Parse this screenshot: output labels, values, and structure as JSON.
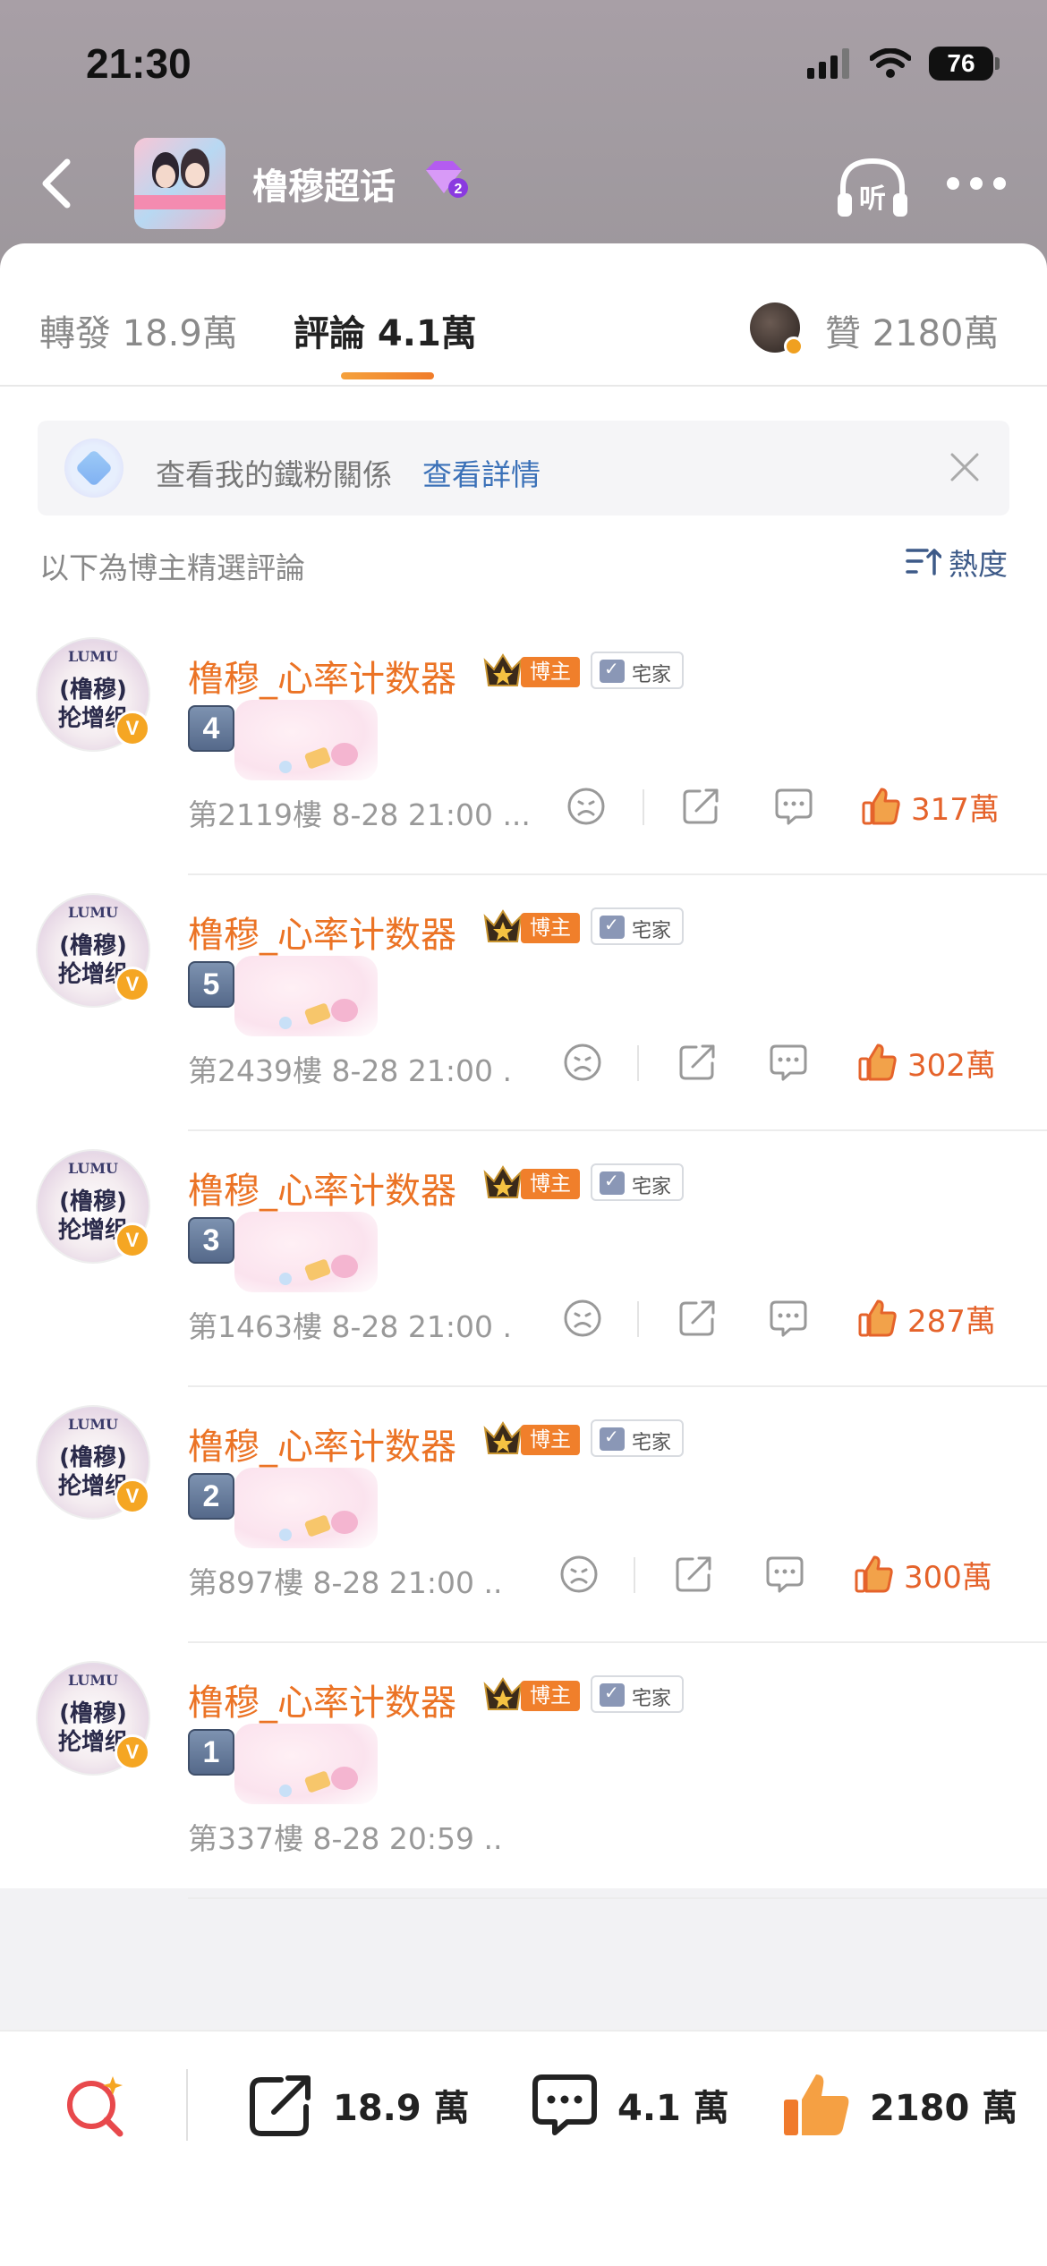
{
  "status_bar": {
    "time": "21:30",
    "battery": "76"
  },
  "header": {
    "group_name": "橹穆超话",
    "listen_label": "听"
  },
  "tabs": {
    "repost": "轉發 18.9萬",
    "comment": "評論 4.1萬",
    "likes": "贊 2180萬"
  },
  "fans_banner": {
    "text": "查看我的鐵粉關係",
    "link": "查看詳情"
  },
  "section": {
    "label": "以下為博主精選評論",
    "sort": "熱度"
  },
  "comments": [
    {
      "name": "橹穆_心率计数器",
      "role": "博主",
      "tag": "宅家",
      "number": "4",
      "meta": "第2119樓 8-28 21:00 ...",
      "likes": "317萬"
    },
    {
      "name": "橹穆_心率计数器",
      "role": "博主",
      "tag": "宅家",
      "number": "5",
      "meta": "第2439樓 8-28 21:00 .",
      "likes": "302萬"
    },
    {
      "name": "橹穆_心率计数器",
      "role": "博主",
      "tag": "宅家",
      "number": "3",
      "meta": "第1463樓 8-28 21:00 .",
      "likes": "287萬"
    },
    {
      "name": "橹穆_心率计数器",
      "role": "博主",
      "tag": "宅家",
      "number": "2",
      "meta": "第897樓 8-28 21:00 ..",
      "likes": "300萬"
    },
    {
      "name": "橹穆_心率计数器",
      "role": "博主",
      "tag": "宅家",
      "number": "1",
      "meta": "第337樓 8-28 20:59 ..",
      "likes": ""
    }
  ],
  "avatar_text": {
    "brand": "LUMU",
    "line1": "(橹穆)",
    "line2": "抡增组",
    "badge": "V"
  },
  "bottom_bar": {
    "reposts": "18.9 萬",
    "comments": "4.1 萬",
    "likes": "2180 萬"
  },
  "colors": {
    "accent": "#eb7325",
    "link": "#3b71b8",
    "like": "#e5632b"
  }
}
